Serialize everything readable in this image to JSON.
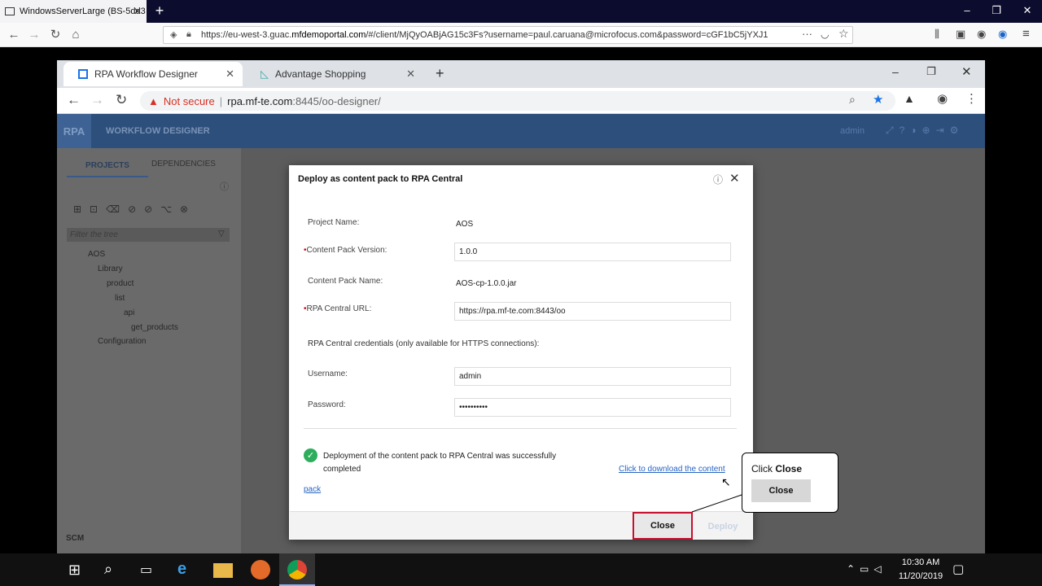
{
  "firefox": {
    "tab_title": "WindowsServerLarge (BS-5dd3",
    "url": "https://eu-west-3.guac.",
    "url_host": "mfdemoportal.com",
    "url_rest": "/#/client/MjQyOABjAG15c3Fs?username=paul.caruana@microfocus.com&password=cGF1bC5jYXJ1"
  },
  "chrome": {
    "tab1": "RPA Workflow Designer",
    "tab2": "Advantage Shopping",
    "not_secure": "Not secure",
    "url_host": "rpa.mf-te.com",
    "url_path": ":8445/oo-designer/"
  },
  "app": {
    "logo": "RPA",
    "title": "WORKFLOW DESIGNER",
    "user": "admin",
    "tabs": [
      "PROJECTS",
      "DEPENDENCIES"
    ],
    "filter_placeholder": "Filter the tree",
    "tree": [
      "AOS",
      "Library",
      "product",
      "list",
      "api",
      "get_products",
      "Configuration"
    ],
    "scm": "SCM"
  },
  "dialog": {
    "title": "Deploy as content pack to RPA Central",
    "project_name_label": "Project Name:",
    "project_name_value": "AOS",
    "version_label": "Content Pack Version:",
    "version_value": "1.0.0",
    "cp_name_label": "Content Pack Name:",
    "cp_name_value": "AOS-cp-1.0.0.jar",
    "url_label": "RPA Central URL:",
    "url_value": "https://rpa.mf-te.com:8443/oo",
    "credentials_note": "RPA Central credentials (only available for HTTPS connections):",
    "username_label": "Username:",
    "username_value": "admin",
    "password_label": "Password:",
    "password_value": "••••••••••",
    "success_line1": "Deployment of the content pack to RPA Central was successfully",
    "success_line2": "completed",
    "download_link": "Click to download the content",
    "download_link2": "pack",
    "close": "Close",
    "deploy": "Deploy"
  },
  "callout": {
    "text_prefix": "Click ",
    "text_bold": "Close",
    "mini_button": "Close"
  },
  "taskbar": {
    "time": "10:30 AM",
    "date": "11/20/2019"
  }
}
